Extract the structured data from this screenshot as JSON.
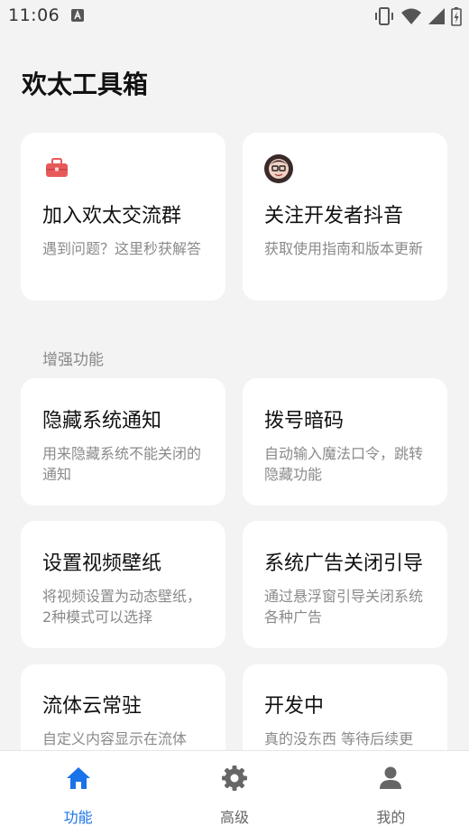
{
  "status_bar": {
    "time": "11:06"
  },
  "page": {
    "title": "欢太工具箱"
  },
  "top_cards": [
    {
      "title": "加入欢太交流群",
      "desc": "遇到问题？这里秒获解答",
      "icon": "toolbox-icon"
    },
    {
      "title": "关注开发者抖音",
      "desc": "获取使用指南和版本更新",
      "icon": "developer-avatar"
    }
  ],
  "section": {
    "label": "增强功能"
  },
  "features": [
    {
      "title": "隐藏系统通知",
      "desc": "用来隐藏系统不能关闭的通知"
    },
    {
      "title": "拨号暗码",
      "desc": "自动输入魔法口令，跳转隐藏功能"
    },
    {
      "title": "设置视频壁纸",
      "desc": "将视频设置为动态壁纸，2种模式可以选择"
    },
    {
      "title": "系统广告关闭引导",
      "desc": "通过悬浮窗引导关闭系统各种广告"
    },
    {
      "title": "流体云常驻",
      "desc": "自定义内容显示在流体"
    },
    {
      "title": "开发中",
      "desc": "真的没东西 等待后续更"
    }
  ],
  "nav": {
    "items": [
      {
        "label": "功能",
        "icon": "home-icon",
        "active": true
      },
      {
        "label": "高级",
        "icon": "gear-icon",
        "active": false
      },
      {
        "label": "我的",
        "icon": "person-icon",
        "active": false
      }
    ]
  },
  "colors": {
    "accent": "#1a73e8",
    "inactive": "#666666",
    "background": "#f3f3f3",
    "card": "#ffffff",
    "toolbox": "#e85a5a"
  }
}
